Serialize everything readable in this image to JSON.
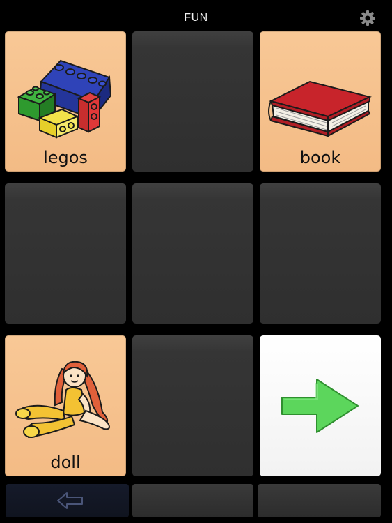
{
  "header": {
    "title": "FUN",
    "settings_icon": "gear-icon"
  },
  "grid": {
    "tiles": [
      {
        "label": "legos",
        "type": "word",
        "icon": "legos-picture"
      },
      {
        "label": "",
        "type": "empty"
      },
      {
        "label": "book",
        "type": "word",
        "icon": "book-picture"
      },
      {
        "label": "",
        "type": "empty"
      },
      {
        "label": "",
        "type": "empty"
      },
      {
        "label": "",
        "type": "empty"
      },
      {
        "label": "doll",
        "type": "word",
        "icon": "doll-picture"
      },
      {
        "label": "",
        "type": "empty"
      },
      {
        "label": "",
        "type": "next",
        "icon": "right-arrow-icon"
      }
    ]
  },
  "footer": {
    "back_icon": "left-arrow-icon"
  },
  "colors": {
    "word_tile": "#f3bb85",
    "empty_tile": "#333333",
    "arrow_green": "#5cd65c",
    "background": "#000000"
  }
}
